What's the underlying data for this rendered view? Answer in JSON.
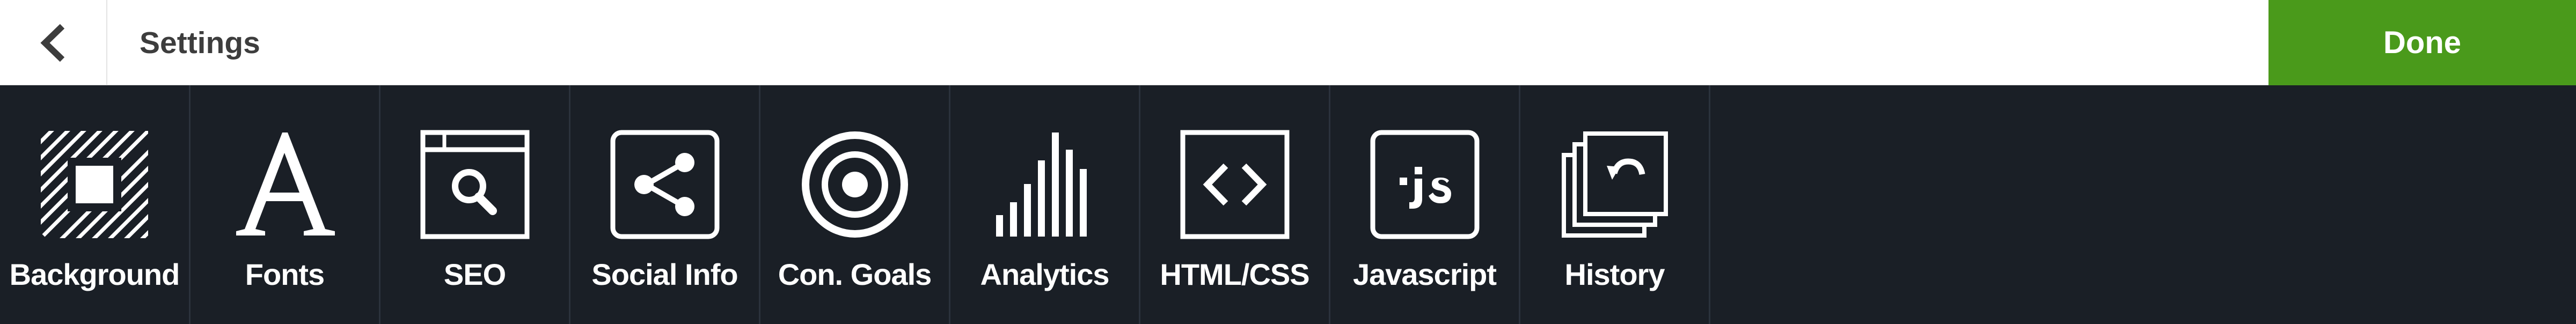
{
  "header": {
    "title": "Settings",
    "done_label": "Done",
    "back_icon": "chevron-left-icon"
  },
  "colors": {
    "done_bg": "#4a9a1b",
    "toolbar_bg": "#1a1f26",
    "header_bg": "#ffffff"
  },
  "tools": [
    {
      "label": "Background",
      "icon": "background-pattern-icon"
    },
    {
      "label": "Fonts",
      "icon": "font-letter-a-icon"
    },
    {
      "label": "SEO",
      "icon": "browser-search-icon"
    },
    {
      "label": "Social Info",
      "icon": "share-icon"
    },
    {
      "label": "Con. Goals",
      "icon": "target-icon"
    },
    {
      "label": "Analytics",
      "icon": "bar-chart-icon"
    },
    {
      "label": "HTML/CSS",
      "icon": "code-brackets-icon"
    },
    {
      "label": "Javascript",
      "icon": "js-file-icon"
    },
    {
      "label": "History",
      "icon": "history-stack-icon"
    }
  ]
}
